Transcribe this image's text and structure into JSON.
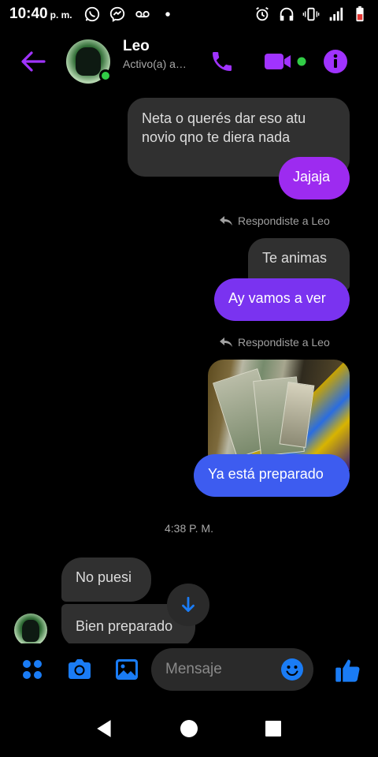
{
  "status_bar": {
    "time": "10:40",
    "meridiem": "p. m.",
    "left_icons": [
      "whatsapp-icon",
      "messenger-icon",
      "voicemail-icon",
      "dot-icon"
    ],
    "right_icons": [
      "alarm-icon",
      "headphones-icon",
      "vibrate-icon",
      "signal-icon",
      "battery-icon"
    ],
    "network": "4G"
  },
  "header": {
    "contact_name": "Leo",
    "contact_status": "Activo(a) a…",
    "accent_color": "#a033ff",
    "online_color": "#31cc46"
  },
  "messages": [
    {
      "type": "received",
      "text": "Neta o querés dar eso atu novio qno te diera nada"
    },
    {
      "type": "sent",
      "text": "Jajaja",
      "color": "#9d2bf0"
    },
    {
      "type": "reply_note",
      "text": "Respondiste a Leo"
    },
    {
      "type": "received",
      "text": "Te animas"
    },
    {
      "type": "sent",
      "text": "Ay vamos a ver",
      "color": "#7a33f0"
    },
    {
      "type": "reply_note",
      "text": "Respondiste a Leo"
    },
    {
      "type": "photo",
      "description": ""
    },
    {
      "type": "sent",
      "text": "Ya está preparado",
      "color": "#3d5cf0"
    },
    {
      "type": "timestamp",
      "text": "4:38 P. M."
    },
    {
      "type": "received",
      "text": "No puesi"
    },
    {
      "type": "received",
      "text": "Bien preparado"
    }
  ],
  "composer": {
    "placeholder": "Mensaje",
    "icons": [
      "apps-icon",
      "camera-icon",
      "gallery-icon",
      "emoji-icon",
      "thumbs-up-icon"
    ],
    "icon_color": "#1a7cf5"
  },
  "navbar": {
    "icons": [
      "back-triangle-icon",
      "home-circle-icon",
      "recents-square-icon"
    ]
  }
}
